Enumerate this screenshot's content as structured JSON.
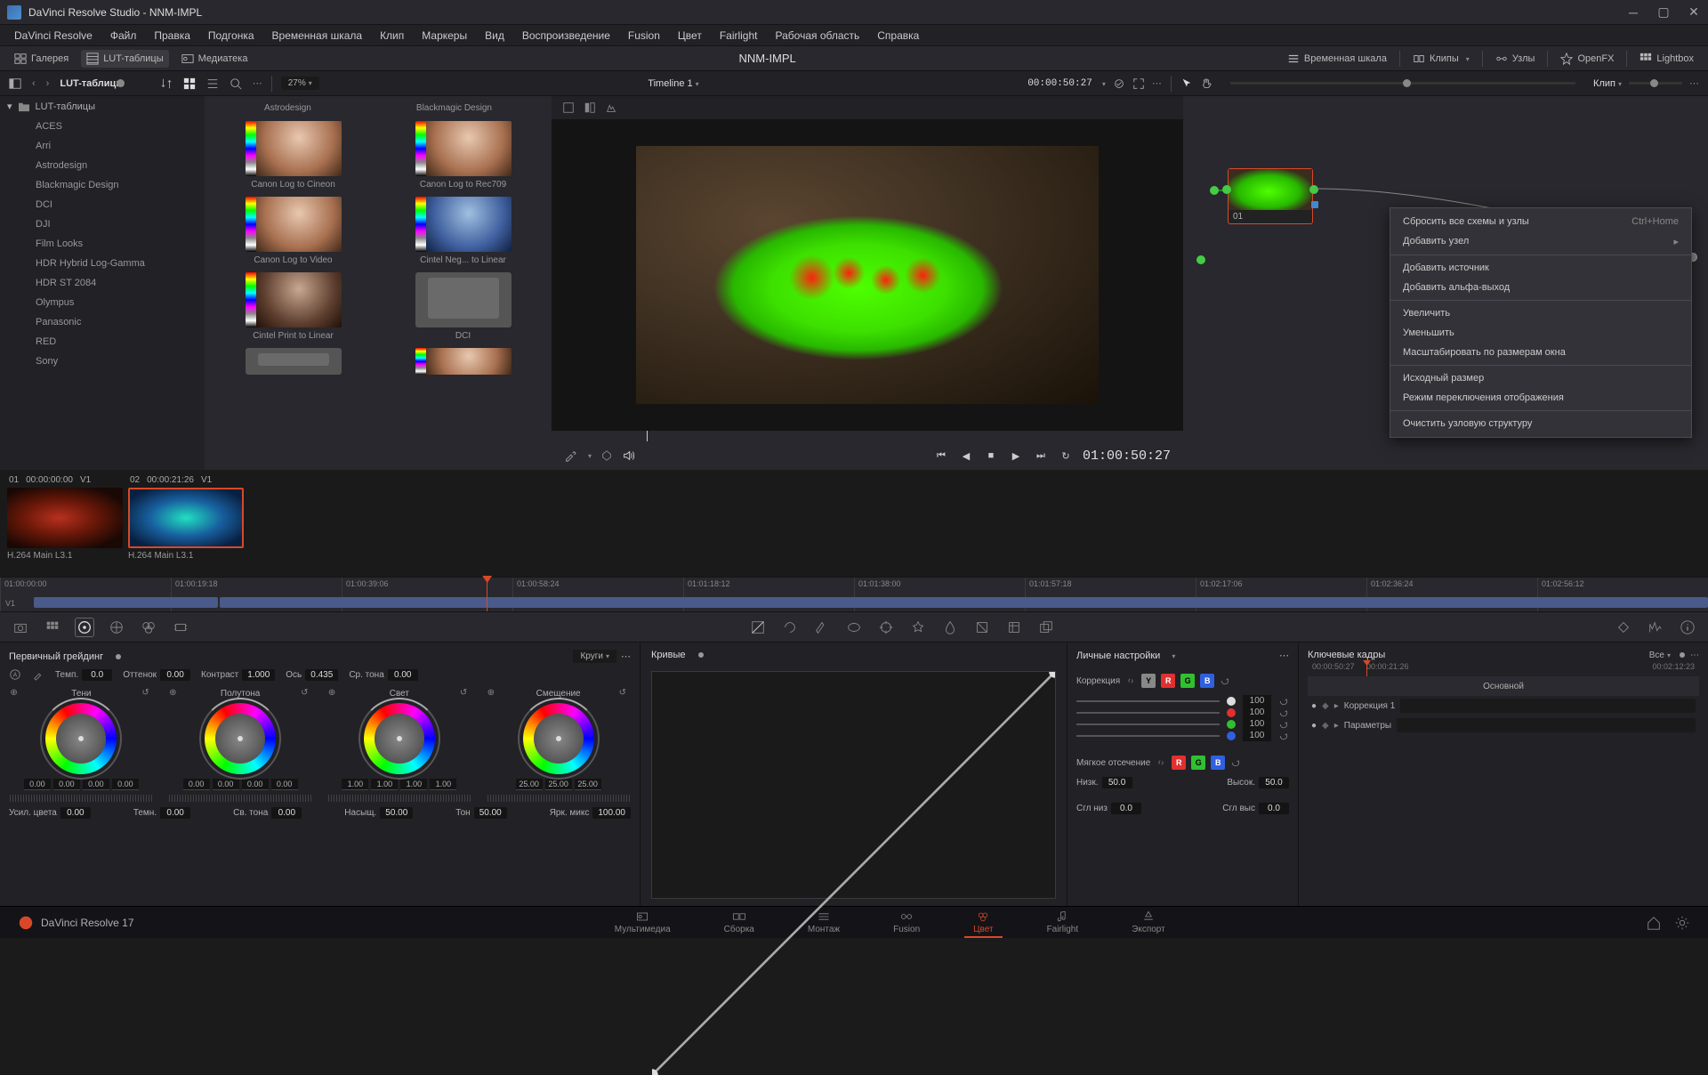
{
  "titlebar": {
    "title": "DaVinci Resolve Studio - NNM-IMPL"
  },
  "menubar": [
    "DaVinci Resolve",
    "Файл",
    "Правка",
    "Подгонка",
    "Временная шкала",
    "Клип",
    "Маркеры",
    "Вид",
    "Воспроизведение",
    "Fusion",
    "Цвет",
    "Fairlight",
    "Рабочая область",
    "Справка"
  ],
  "toolbar": {
    "gallery": "Галерея",
    "luts": "LUT-таблицы",
    "media": "Медиатека",
    "project": "NNM-IMPL",
    "timeline": "Временная шкала",
    "clips": "Клипы",
    "nodes": "Узлы",
    "openfx": "OpenFX",
    "lightbox": "Lightbox"
  },
  "subhead": {
    "lut_title": "LUT-таблицы",
    "zoom": "27%",
    "timeline_name": "Timeline 1",
    "timecode_top": "00:00:50:27",
    "node_mode": "Клип"
  },
  "lut_root": "LUT-таблицы",
  "lut_folders": [
    "ACES",
    "Arri",
    "Astrodesign",
    "Blackmagic Design",
    "DCI",
    "DJI",
    "Film Looks",
    "HDR Hybrid Log-Gamma",
    "HDR ST 2084",
    "Olympus",
    "Panasonic",
    "RED",
    "Sony"
  ],
  "lut_truncated": [
    "Astrodesign",
    "Blackmagic Design"
  ],
  "luts": [
    "Canon Log to Cineon",
    "Canon Log to Rec709",
    "Canon Log to Video",
    "Cintel Neg... to Linear",
    "Cintel Print to Linear",
    "DCI"
  ],
  "viewer": {
    "timecode": "01:00:50:27"
  },
  "node": {
    "label": "01"
  },
  "context_menu": [
    {
      "label": "Сбросить все схемы и узлы",
      "shortcut": "Ctrl+Home"
    },
    {
      "label": "Добавить узел",
      "sub": true
    },
    {
      "sep": true
    },
    {
      "label": "Добавить источник"
    },
    {
      "label": "Добавить альфа-выход"
    },
    {
      "sep": true
    },
    {
      "label": "Увеличить"
    },
    {
      "label": "Уменьшить"
    },
    {
      "label": "Масштабировать по размерам окна"
    },
    {
      "sep": true
    },
    {
      "label": "Исходный размер"
    },
    {
      "label": "Режим переключения отображения"
    },
    {
      "sep": true
    },
    {
      "label": "Очистить узловую структуру"
    }
  ],
  "clips": [
    {
      "idx": "01",
      "tc": "00:00:00:00",
      "track": "V1",
      "name": "H.264 Main L3.1"
    },
    {
      "idx": "02",
      "tc": "00:00:21:26",
      "track": "V1",
      "name": "H.264 Main L3.1"
    }
  ],
  "ruler": [
    "01:00:00:00",
    "01:00:19:18",
    "01:00:39:06",
    "01:00:58:24",
    "01:01:18:12",
    "01:01:38:00",
    "01:01:57:18",
    "01:02:17:06",
    "01:02:36:24",
    "01:02:56:12"
  ],
  "track_label": "V1",
  "primary": {
    "title": "Первичный грейдинг",
    "mode": "Круги",
    "temp_lbl": "Темп.",
    "temp": "0.0",
    "tint_lbl": "Оттенок",
    "tint": "0.00",
    "contrast_lbl": "Контраст",
    "contrast": "1.000",
    "pivot_lbl": "Ось",
    "pivot": "0.435",
    "mid_lbl": "Ср. тона",
    "mid": "0.00",
    "wheels": [
      {
        "name": "Тени",
        "vals": [
          "0.00",
          "0.00",
          "0.00",
          "0.00"
        ]
      },
      {
        "name": "Полутона",
        "vals": [
          "0.00",
          "0.00",
          "0.00",
          "0.00"
        ]
      },
      {
        "name": "Свет",
        "vals": [
          "1.00",
          "1.00",
          "1.00",
          "1.00"
        ]
      },
      {
        "name": "Смещение",
        "vals": [
          "25.00",
          "25.00",
          "25.00"
        ]
      }
    ],
    "bottom": [
      {
        "lbl": "Усил. цвета",
        "v": "0.00"
      },
      {
        "lbl": "Темн.",
        "v": "0.00"
      },
      {
        "lbl": "Св. тона",
        "v": "0.00"
      },
      {
        "lbl": "Насыщ.",
        "v": "50.00"
      },
      {
        "lbl": "Тон",
        "v": "50.00"
      },
      {
        "lbl": "Ярк. микс",
        "v": "100.00"
      }
    ]
  },
  "curves": {
    "title": "Кривые"
  },
  "custom": {
    "title": "Личные настройки",
    "correction": "Коррекция",
    "sliders": [
      {
        "color": "#ddd",
        "v": "100"
      },
      {
        "color": "#e03030",
        "v": "100"
      },
      {
        "color": "#30c030",
        "v": "100"
      },
      {
        "color": "#3060e0",
        "v": "100"
      }
    ],
    "softclip": "Мягкое отсечение",
    "low_lbl": "Низк.",
    "low": "50.0",
    "high_lbl": "Высок.",
    "high": "50.0",
    "ls_lbl": "Сгл низ",
    "ls": "0.0",
    "hs_lbl": "Сгл выс",
    "hs": "0.0"
  },
  "keyframes": {
    "title": "Ключевые кадры",
    "mode": "Все",
    "tcs": [
      "00:00:50:27",
      "00:00:21:26",
      "00:02:12:23"
    ],
    "master": "Основной",
    "rows": [
      "Коррекция 1",
      "Параметры"
    ]
  },
  "pages": {
    "logo": "DaVinci Resolve 17",
    "tabs": [
      "Мультимедиа",
      "Сборка",
      "Монтаж",
      "Fusion",
      "Цвет",
      "Fairlight",
      "Экспорт"
    ],
    "active": 4
  }
}
